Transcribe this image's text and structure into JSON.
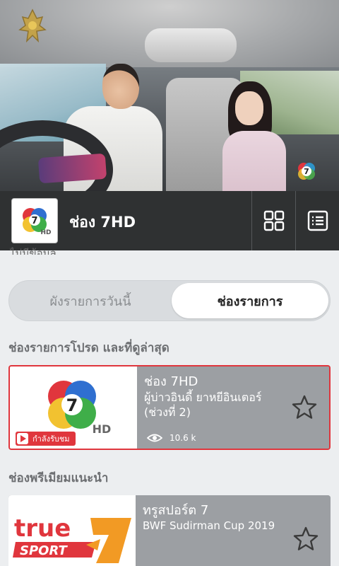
{
  "player": {
    "emblem_icon": "royal-emblem-icon",
    "overlay_icon": "channel7-watermark-icon"
  },
  "channel_bar": {
    "title": "ช่อง 7HD",
    "logo_icon": "channel7hd-logo-icon",
    "grid_icon": "grid-icon",
    "list_icon": "list-icon"
  },
  "content": {
    "partial_text": "ไม่มีข้อมูล",
    "tabs": [
      {
        "label": "ผังรายการวันนี้",
        "selected": false
      },
      {
        "label": "ช่องรายการ",
        "selected": true
      }
    ],
    "section_recent": "ช่องรายการโปรด และที่ดูล่าสุด",
    "section_premium": "ช่องพรีเมียมแนะนำ"
  },
  "cards": [
    {
      "channel": "ช่อง 7HD",
      "program": "ผู้บ่าวอินดี้ ยาหยีอินเตอร์ (ช่วงที่ 2)",
      "views": "10.6 k",
      "live_label": "กำลังรับชม",
      "logo": "channel7hd-logo-icon"
    },
    {
      "channel": "ทรูสปอร์ต 7",
      "program": "BWF Sudirman Cup 2019",
      "logo": "truesport7-logo-icon"
    }
  ],
  "colors": {
    "accent": "#e0363d",
    "bar": "#2f3132",
    "card": "#9c9fa3",
    "background": "#eceef0"
  }
}
